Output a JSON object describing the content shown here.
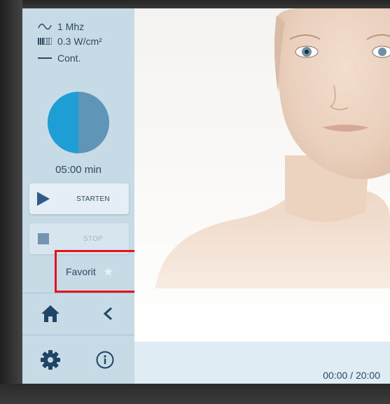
{
  "params": {
    "frequency": "1 Mhz",
    "intensity": "0.3 W/cm²",
    "mode": "Cont."
  },
  "timer": {
    "remaining": "05:00 min",
    "progress_fraction": 0.5
  },
  "buttons": {
    "start_label": "STARTEN",
    "stop_label": "STOP"
  },
  "favorite": {
    "label": "Favorit"
  },
  "status": {
    "elapsed_total": "00:00 / 20:00"
  },
  "icons": [
    "sine-wave-icon",
    "pulse-bars-icon",
    "continuous-line-icon",
    "play-icon",
    "stop-icon",
    "star-icon",
    "home-icon",
    "back-chevron-icon",
    "gear-icon",
    "info-icon"
  ],
  "colors": {
    "accent": "#2f6f9a",
    "pie_light": "#1f9ed6",
    "pie_dark": "#5f96b8",
    "highlight": "#e5131a"
  }
}
